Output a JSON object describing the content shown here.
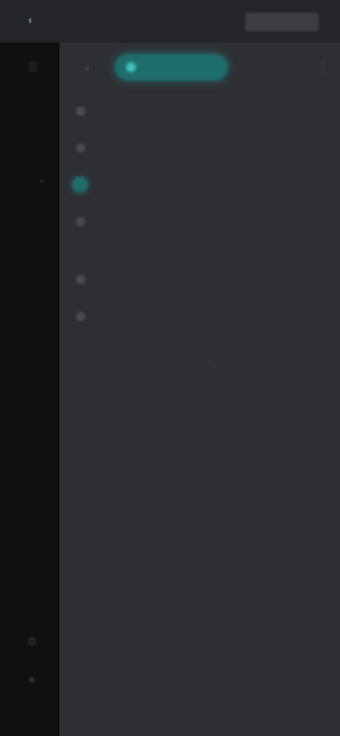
{
  "topbar": {
    "app_logo_icon": "logo-icon",
    "app_name": "",
    "action_label": ""
  },
  "rail": {
    "items": [
      {
        "icon": "menu-icon"
      },
      {
        "icon": "dot-icon"
      },
      {
        "icon": "settings-icon"
      },
      {
        "icon": "user-icon"
      }
    ]
  },
  "main": {
    "back_icon": "chevron-left-icon",
    "primary_chip_label": "",
    "more_icon": "more-vertical-icon",
    "list": [
      {
        "label": "",
        "active": false
      },
      {
        "label": "",
        "active": false
      },
      {
        "label": "",
        "active": true
      },
      {
        "label": "",
        "active": false
      },
      {
        "label": "",
        "active": false
      },
      {
        "label": "",
        "active": false
      }
    ],
    "select_value": "",
    "footer_link": ""
  },
  "colors": {
    "accent": "#1e6d6c",
    "accent_glow": "#3fc3bd",
    "background": "#2e2f32",
    "rail": "#101012",
    "topbar": "#242528"
  }
}
